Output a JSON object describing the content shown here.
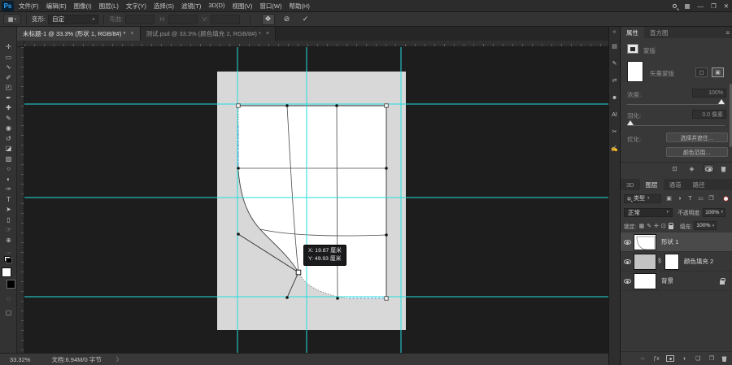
{
  "window": {
    "logo_text": "Ps",
    "minimize": "—",
    "maximize": "❐",
    "close": "✕",
    "workspace_icon_glyph": "▦"
  },
  "menu_bar": {
    "items": [
      "文件(F)",
      "编辑(E)",
      "图像(I)",
      "图层(L)",
      "文字(Y)",
      "选择(S)",
      "滤镜(T)",
      "3D(D)",
      "视图(V)",
      "窗口(W)",
      "帮助(H)"
    ]
  },
  "options_bar": {
    "tool_preset_glyph": "▦",
    "warp_label": "变形:",
    "warp_value": "自定",
    "bend_label": "弯曲:",
    "h_label": "H:",
    "v_label": "V:",
    "mode_switch_glyph": "❖",
    "cancel_glyph": "⊘",
    "commit_glyph": "✓"
  },
  "document_tabs": [
    {
      "title": "未标题-1 @ 33.3% (形状 1, RGB/8#) *",
      "close": "×",
      "active": true
    },
    {
      "title": "测试.psd @ 33.3% (颜色填充 2, RGB/8#) *",
      "close": "×",
      "active": false
    }
  ],
  "toolbar": {
    "tools": [
      {
        "name": "move-tool",
        "glyph": "✛"
      },
      {
        "name": "rectangular-marquee-tool",
        "glyph": "▭"
      },
      {
        "name": "lasso-tool",
        "glyph": "∿"
      },
      {
        "name": "quick-selection-tool",
        "glyph": "✐"
      },
      {
        "name": "crop-tool",
        "glyph": "◰"
      },
      {
        "name": "eyedropper-tool",
        "glyph": "✒"
      },
      {
        "name": "spot-healing-brush-tool",
        "glyph": "✚"
      },
      {
        "name": "brush-tool",
        "glyph": "✎"
      },
      {
        "name": "clone-stamp-tool",
        "glyph": "◉"
      },
      {
        "name": "history-brush-tool",
        "glyph": "↺"
      },
      {
        "name": "eraser-tool",
        "glyph": "◪"
      },
      {
        "name": "gradient-tool",
        "glyph": "▨"
      },
      {
        "name": "blur-tool",
        "glyph": "○"
      },
      {
        "name": "dodge-tool",
        "glyph": "◐"
      },
      {
        "name": "pen-tool",
        "glyph": "✑"
      },
      {
        "name": "type-tool",
        "glyph": "T"
      },
      {
        "name": "path-selection-tool",
        "glyph": "➤"
      },
      {
        "name": "rectangle-tool",
        "glyph": "▯"
      },
      {
        "name": "hand-tool",
        "glyph": "☞"
      },
      {
        "name": "zoom-tool",
        "glyph": "⊕"
      }
    ],
    "more_tools_glyph": "···",
    "quick_mask_glyph": "◌",
    "screen_mode_glyph": "▢"
  },
  "canvas": {
    "tooltip_x": "X: 19.87 厘米",
    "tooltip_y": "Y: 49.93 厘米",
    "guide_color": "#22dede"
  },
  "dock_strip": {
    "expand_glyph": "«",
    "icons": [
      {
        "name": "swatches-panel-icon",
        "glyph": "▤"
      },
      {
        "name": "brush-settings-panel-icon",
        "glyph": "✎"
      },
      {
        "name": "adjustments-panel-icon",
        "glyph": "⇄"
      },
      {
        "name": "libraries-panel-icon",
        "glyph": "☻"
      },
      {
        "name": "ai-panel-icon",
        "glyph": "AI"
      },
      {
        "name": "actions-panel-icon",
        "glyph": "✂"
      },
      {
        "name": "tool-presets-panel-icon",
        "glyph": "✍"
      }
    ]
  },
  "properties_panel": {
    "tab_properties": "属性",
    "tab_histogram": "直方图",
    "menu_glyph": "≡",
    "mask_section_label": "蒙版",
    "mask_type_label": "矢量蒙版",
    "pixel_mask_btn_glyph": "◻",
    "vector_mask_btn_glyph": "▣",
    "density_label": "浓度:",
    "density_value": "100%",
    "feather_label": "羽化:",
    "feather_value": "0.0 像素",
    "refine_label": "优化:",
    "refine_buttons": [
      "选择并遮住…",
      "颜色范围…"
    ],
    "footer_icons": [
      {
        "name": "load-selection-from-mask-icon",
        "glyph": "⊡"
      },
      {
        "name": "apply-mask-icon",
        "glyph": "◈"
      },
      {
        "name": "mask-visibility-icon",
        "type": "eye",
        "active": true
      },
      {
        "name": "delete-mask-icon",
        "type": "trash"
      }
    ]
  },
  "layers_panel": {
    "tabs": [
      {
        "label": "3D",
        "active": false
      },
      {
        "label": "图层",
        "active": true
      },
      {
        "label": "通道",
        "active": false
      },
      {
        "label": "路径",
        "active": false
      }
    ],
    "menu_glyph": "≡",
    "filter_label": "类型",
    "filter_icons": [
      {
        "name": "filter-pixel-layers-icon",
        "glyph": "▣"
      },
      {
        "name": "filter-adjustment-layers-icon",
        "glyph": "◑"
      },
      {
        "name": "filter-type-layers-icon",
        "glyph": "T"
      },
      {
        "name": "filter-shape-layers-icon",
        "glyph": "▭"
      },
      {
        "name": "filter-smart-objects-icon",
        "glyph": "❐"
      }
    ],
    "blend_mode": "正常",
    "opacity_label": "不透明度:",
    "opacity_value": "100%",
    "lock_label": "锁定:",
    "lock_icons": [
      {
        "name": "lock-transparent-pixels-icon",
        "glyph": "▦"
      },
      {
        "name": "lock-image-pixels-icon",
        "glyph": "✎"
      },
      {
        "name": "lock-position-icon",
        "glyph": "✛"
      },
      {
        "name": "lock-artboard-icon",
        "glyph": "⊡"
      },
      {
        "name": "lock-all-icon",
        "type": "lock"
      }
    ],
    "fill_label": "填充:",
    "fill_value": "100%",
    "layers": [
      {
        "name": "形状 1",
        "selected": true
      },
      {
        "name": "颜色填充 2",
        "selected": false
      },
      {
        "name": "背景",
        "selected": false,
        "locked": true
      }
    ],
    "link_glyph": "§",
    "footer_icons": [
      {
        "name": "link-layers-icon",
        "glyph": "∞",
        "disabled": true
      },
      {
        "name": "layer-effects-icon",
        "glyph": "ƒx"
      },
      {
        "name": "add-layer-mask-icon",
        "type": "mask"
      },
      {
        "name": "new-adjustment-layer-icon",
        "glyph": "◑"
      },
      {
        "name": "new-group-icon",
        "glyph": "❏"
      },
      {
        "name": "new-layer-icon",
        "glyph": "❐"
      },
      {
        "name": "delete-layer-icon",
        "type": "trash"
      }
    ]
  },
  "status_bar": {
    "zoom": "33.32%",
    "document_info": "文档:6.94M/0 字节",
    "expand_arrow": "〉"
  }
}
